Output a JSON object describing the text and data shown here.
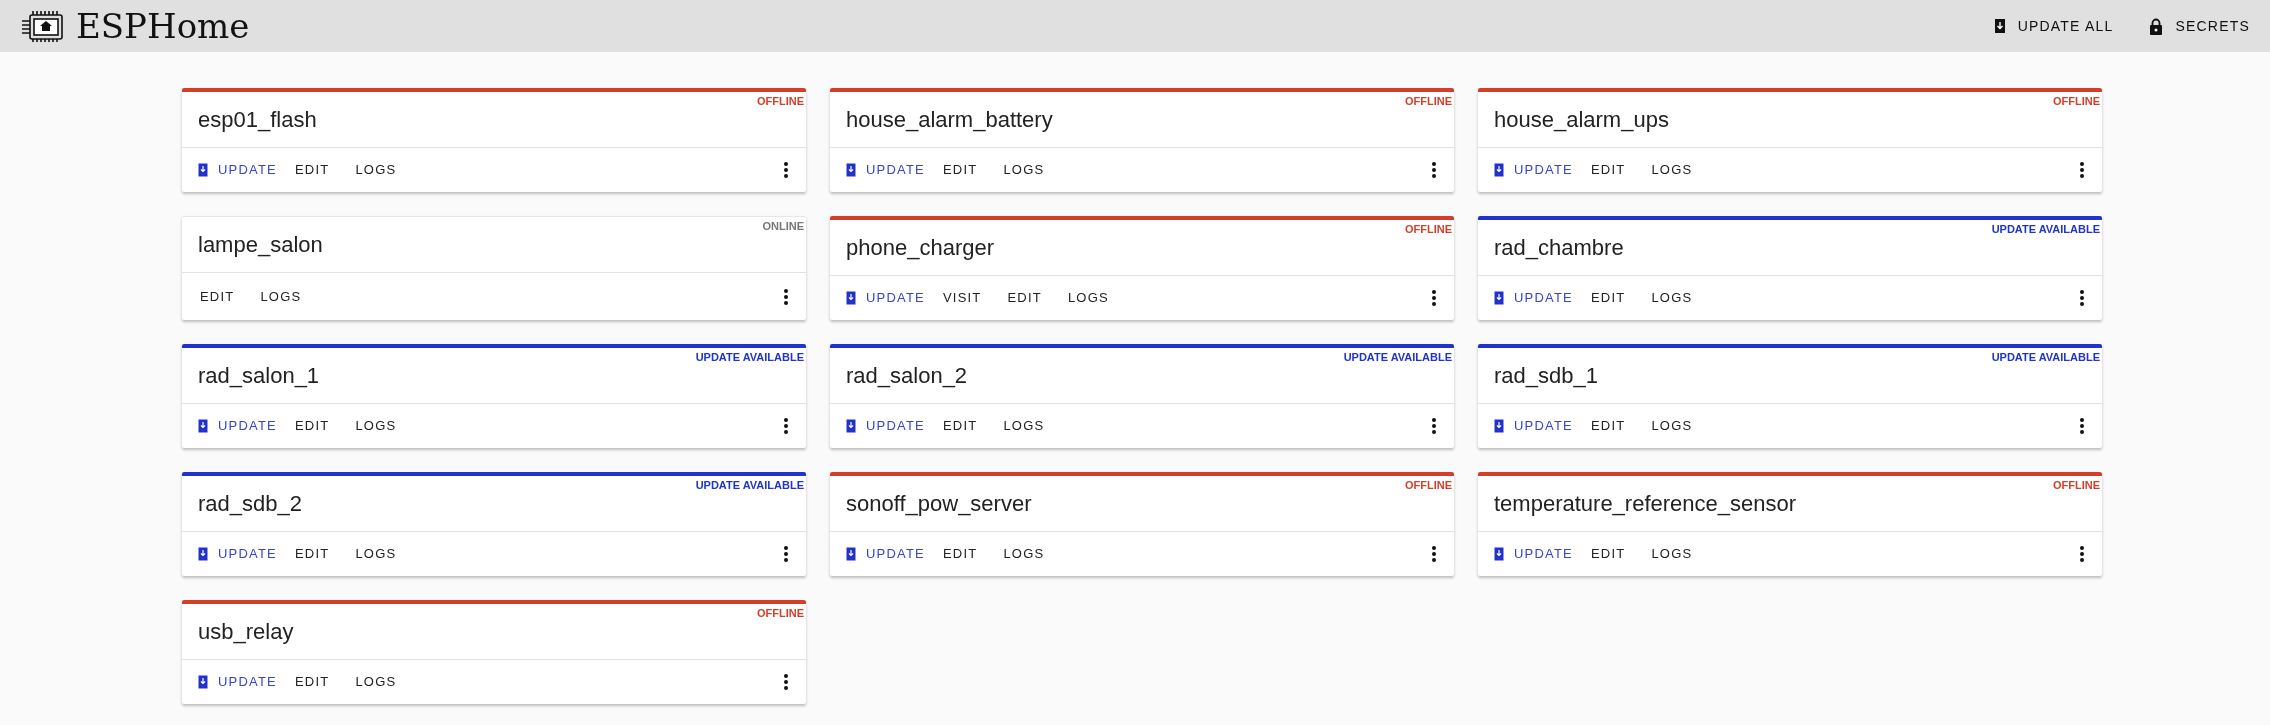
{
  "header": {
    "title": "ESPHome",
    "actions": [
      {
        "kind": "update_all",
        "label": "UPDATE ALL"
      },
      {
        "kind": "secrets",
        "label": "SECRETS"
      }
    ]
  },
  "devices": [
    {
      "name": "esp01_flash",
      "kind": "offline",
      "status_label": "OFFLINE",
      "actions": [
        {
          "kind": "update",
          "label": "UPDATE"
        },
        {
          "kind": "plain",
          "label": "EDIT"
        },
        {
          "kind": "plain",
          "label": "LOGS"
        }
      ]
    },
    {
      "name": "house_alarm_battery",
      "kind": "offline",
      "status_label": "OFFLINE",
      "actions": [
        {
          "kind": "update",
          "label": "UPDATE"
        },
        {
          "kind": "plain",
          "label": "EDIT"
        },
        {
          "kind": "plain",
          "label": "LOGS"
        }
      ]
    },
    {
      "name": "house_alarm_ups",
      "kind": "offline",
      "status_label": "OFFLINE",
      "actions": [
        {
          "kind": "update",
          "label": "UPDATE"
        },
        {
          "kind": "plain",
          "label": "EDIT"
        },
        {
          "kind": "plain",
          "label": "LOGS"
        }
      ]
    },
    {
      "name": "lampe_salon",
      "kind": "online",
      "status_label": "ONLINE",
      "actions": [
        {
          "kind": "plain",
          "label": "EDIT"
        },
        {
          "kind": "plain",
          "label": "LOGS"
        }
      ]
    },
    {
      "name": "phone_charger",
      "kind": "offline",
      "status_label": "OFFLINE",
      "actions": [
        {
          "kind": "update",
          "label": "UPDATE"
        },
        {
          "kind": "plain",
          "label": "VISIT"
        },
        {
          "kind": "plain",
          "label": "EDIT"
        },
        {
          "kind": "plain",
          "label": "LOGS"
        }
      ]
    },
    {
      "name": "rad_chambre",
      "kind": "update",
      "status_label": "UPDATE AVAILABLE",
      "actions": [
        {
          "kind": "update",
          "label": "UPDATE"
        },
        {
          "kind": "plain",
          "label": "EDIT"
        },
        {
          "kind": "plain",
          "label": "LOGS"
        }
      ]
    },
    {
      "name": "rad_salon_1",
      "kind": "update",
      "status_label": "UPDATE AVAILABLE",
      "actions": [
        {
          "kind": "update",
          "label": "UPDATE"
        },
        {
          "kind": "plain",
          "label": "EDIT"
        },
        {
          "kind": "plain",
          "label": "LOGS"
        }
      ]
    },
    {
      "name": "rad_salon_2",
      "kind": "update",
      "status_label": "UPDATE AVAILABLE",
      "actions": [
        {
          "kind": "update",
          "label": "UPDATE"
        },
        {
          "kind": "plain",
          "label": "EDIT"
        },
        {
          "kind": "plain",
          "label": "LOGS"
        }
      ]
    },
    {
      "name": "rad_sdb_1",
      "kind": "update",
      "status_label": "UPDATE AVAILABLE",
      "actions": [
        {
          "kind": "update",
          "label": "UPDATE"
        },
        {
          "kind": "plain",
          "label": "EDIT"
        },
        {
          "kind": "plain",
          "label": "LOGS"
        }
      ]
    },
    {
      "name": "rad_sdb_2",
      "kind": "update",
      "status_label": "UPDATE AVAILABLE",
      "actions": [
        {
          "kind": "update",
          "label": "UPDATE"
        },
        {
          "kind": "plain",
          "label": "EDIT"
        },
        {
          "kind": "plain",
          "label": "LOGS"
        }
      ]
    },
    {
      "name": "sonoff_pow_server",
      "kind": "offline",
      "status_label": "OFFLINE",
      "actions": [
        {
          "kind": "update",
          "label": "UPDATE"
        },
        {
          "kind": "plain",
          "label": "EDIT"
        },
        {
          "kind": "plain",
          "label": "LOGS"
        }
      ]
    },
    {
      "name": "temperature_reference_sensor",
      "kind": "offline",
      "status_label": "OFFLINE",
      "actions": [
        {
          "kind": "update",
          "label": "UPDATE"
        },
        {
          "kind": "plain",
          "label": "EDIT"
        },
        {
          "kind": "plain",
          "label": "LOGS"
        }
      ]
    },
    {
      "name": "usb_relay",
      "kind": "offline",
      "status_label": "OFFLINE",
      "actions": [
        {
          "kind": "update",
          "label": "UPDATE"
        },
        {
          "kind": "plain",
          "label": "EDIT"
        },
        {
          "kind": "plain",
          "label": "LOGS"
        }
      ]
    }
  ]
}
